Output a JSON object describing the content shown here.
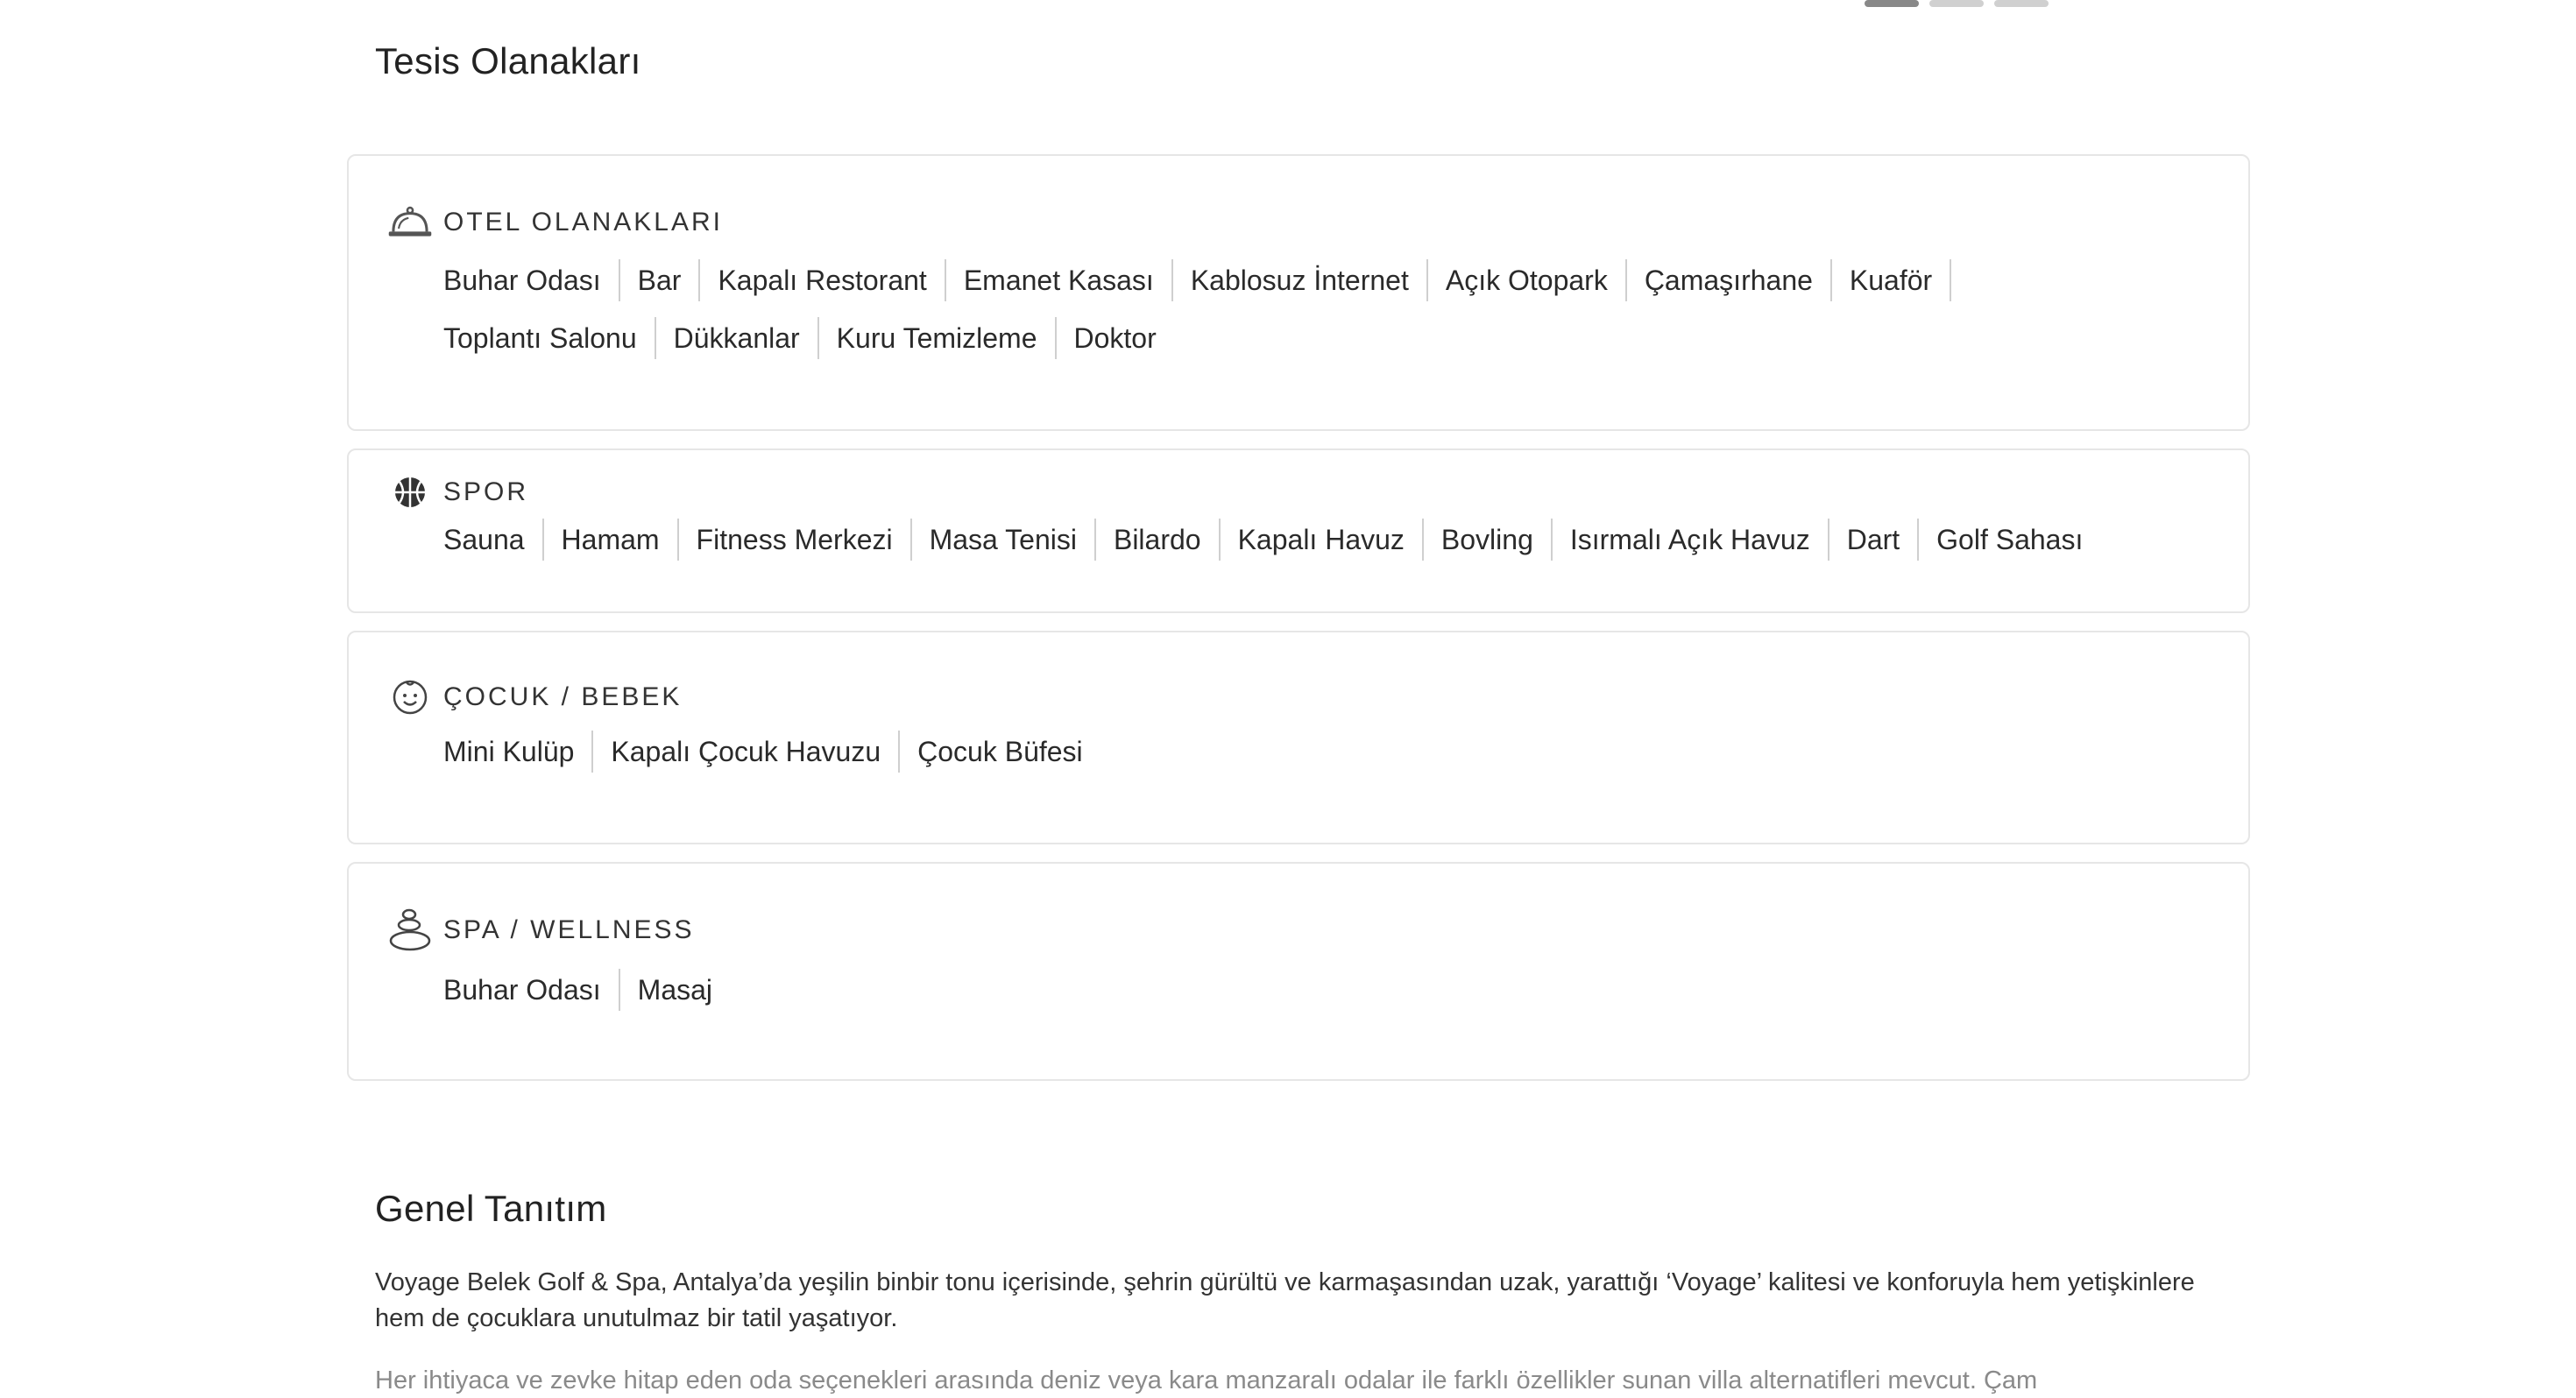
{
  "slider": {
    "dots": 3,
    "active_index": 0
  },
  "facilities": {
    "title": "Tesis Olanakları",
    "categories": [
      {
        "label": "OTEL OLANAKLARI",
        "icon": "service-bell-icon",
        "items": [
          "Buhar Odası",
          "Bar",
          "Kapalı Restorant",
          "Emanet Kasası",
          "Kablosuz İnternet",
          "Açık Otopark",
          "Çamaşırhane",
          "Kuaför",
          "Toplantı Salonu",
          "Dükkanlar",
          "Kuru Temizleme",
          "Doktor"
        ]
      },
      {
        "label": "SPOR",
        "icon": "basketball-icon",
        "items": [
          "Sauna",
          "Hamam",
          "Fitness Merkezi",
          "Masa Tenisi",
          "Bilardo",
          "Kapalı Havuz",
          "Bovling",
          "Isırmalı Açık Havuz",
          "Dart",
          "Golf Sahası"
        ]
      },
      {
        "label": "ÇOCUK / BEBEK",
        "icon": "baby-face-icon",
        "items": [
          "Mini Kulüp",
          "Kapalı Çocuk Havuzu",
          "Çocuk Büfesi"
        ]
      },
      {
        "label": "SPA / WELLNESS",
        "icon": "spa-stones-icon",
        "items": [
          "Buhar Odası",
          "Masaj"
        ]
      }
    ]
  },
  "intro": {
    "title": "Genel Tanıtım",
    "paragraph1": "Voyage Belek Golf & Spa, Antalya’da yeşilin binbir tonu içerisinde, şehrin gürültü ve karmaşasından uzak, yarattığı ‘Voyage’ kalitesi ve konforuyla hem yetişkinlere hem de çocuklara unutulmaz bir tatil yaşatıyor.",
    "paragraph2": "Her ihtiyaca ve zevke hitap eden oda seçenekleri arasında deniz veya kara manzaralı odalar ile farklı özellikler sunan villa alternatifleri mevcut. Çam"
  }
}
